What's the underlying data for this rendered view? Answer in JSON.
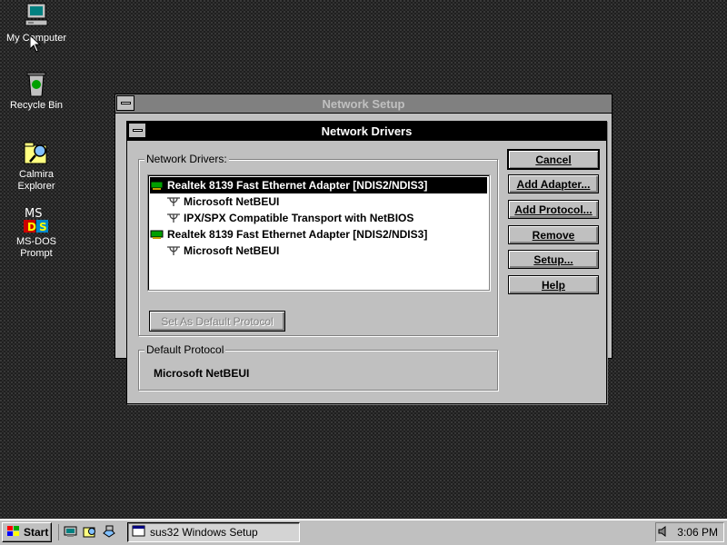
{
  "desktop": {
    "icons": [
      {
        "label": "My Computer",
        "icon": "computer-icon"
      },
      {
        "label": "Recycle Bin",
        "icon": "recycle-bin-icon"
      },
      {
        "label": "Calmira Explorer",
        "icon": "explorer-icon"
      },
      {
        "label": "MS-DOS Prompt",
        "icon": "msdos-icon"
      }
    ]
  },
  "network_setup": {
    "title": "Network Setup"
  },
  "network_drivers": {
    "title": "Network Drivers",
    "group_label": "Network Drivers:",
    "items": [
      {
        "text": "Realtek 8139 Fast Ethernet Adapter [NDIS2/NDIS3]",
        "kind": "adapter",
        "selected": true
      },
      {
        "text": "Microsoft NetBEUI",
        "kind": "protocol",
        "selected": false
      },
      {
        "text": "IPX/SPX Compatible Transport with NetBIOS",
        "kind": "protocol",
        "selected": false
      },
      {
        "text": "Realtek 8139 Fast Ethernet Adapter [NDIS2/NDIS3]",
        "kind": "adapter",
        "selected": false
      },
      {
        "text": "Microsoft NetBEUI",
        "kind": "protocol",
        "selected": false
      }
    ],
    "set_default_label": "Set As Default Protocol",
    "default_protocol_label": "Default Protocol",
    "default_protocol_value": "Microsoft NetBEUI",
    "buttons": {
      "cancel": "Cancel",
      "add_adapter": "Add Adapter...",
      "add_protocol": "Add Protocol...",
      "remove": "Remove",
      "setup": "Setup...",
      "help": "Help"
    }
  },
  "taskbar": {
    "start_label": "Start",
    "task_label": "sus32 Windows Setup",
    "clock": "3:06 PM"
  }
}
